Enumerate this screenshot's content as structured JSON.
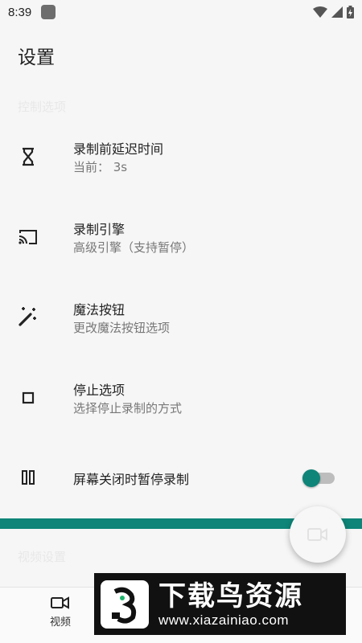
{
  "status_bar": {
    "time": "8:39"
  },
  "page": {
    "title": "设置"
  },
  "sections": {
    "record_options": "控制选项",
    "video_settings": "视频设置"
  },
  "items": [
    {
      "title": "录制前延迟时间",
      "summary": "当前： 3s",
      "icon": "hourglass-icon"
    },
    {
      "title": "录制引擎",
      "summary": "高级引擎（支持暂停）",
      "icon": "cast-icon"
    },
    {
      "title": "魔法按钮",
      "summary": "更改魔法按钮选项",
      "icon": "magic-wand-icon"
    },
    {
      "title": "停止选项",
      "summary": "选择停止录制的方式",
      "icon": "stop-icon"
    },
    {
      "title": "屏幕关闭时暂停录制",
      "icon": "pause-icon",
      "switch_on": true
    }
  ],
  "bottom_nav": {
    "video_label": "视频"
  },
  "watermark": {
    "title": "下载鸟资源",
    "url": "www.xiazainiao.com"
  },
  "colors": {
    "accent": "#0e8578",
    "background": "#f6f6f6"
  }
}
